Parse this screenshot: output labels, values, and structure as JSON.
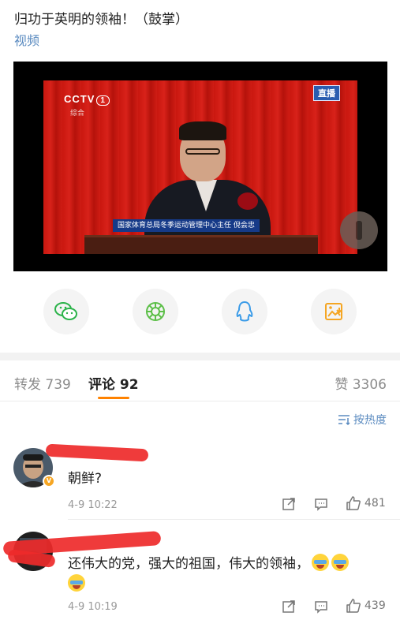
{
  "post": {
    "text": "归功于英明的领袖！（鼓掌）",
    "link": "视频"
  },
  "video": {
    "channel_logo": "CCTV",
    "channel_number": "1",
    "channel_sub": "综合",
    "live_badge": "直播",
    "caption": "国家体育总局冬季运动管理中心主任 倪会忠"
  },
  "share": {
    "icons": [
      "wechat-icon",
      "moments-icon",
      "qq-icon",
      "save-image-icon"
    ],
    "colors": {
      "wechat": "#2bb34a",
      "moments": "#5cbf48",
      "qq": "#3a9be8",
      "save": "#f5a623"
    }
  },
  "tabs": {
    "repost": "转发 739",
    "comments": "评论 92",
    "likes": "赞 3306",
    "accent": "#ff8200"
  },
  "sort": {
    "label": "按热度"
  },
  "comments": [
    {
      "text": "朝鲜?",
      "time": "4-9 10:22",
      "likes": "481"
    },
    {
      "text": "还伟大的党，强大的祖国，伟大的领袖，",
      "time": "4-9 10:19",
      "likes": "439"
    }
  ]
}
